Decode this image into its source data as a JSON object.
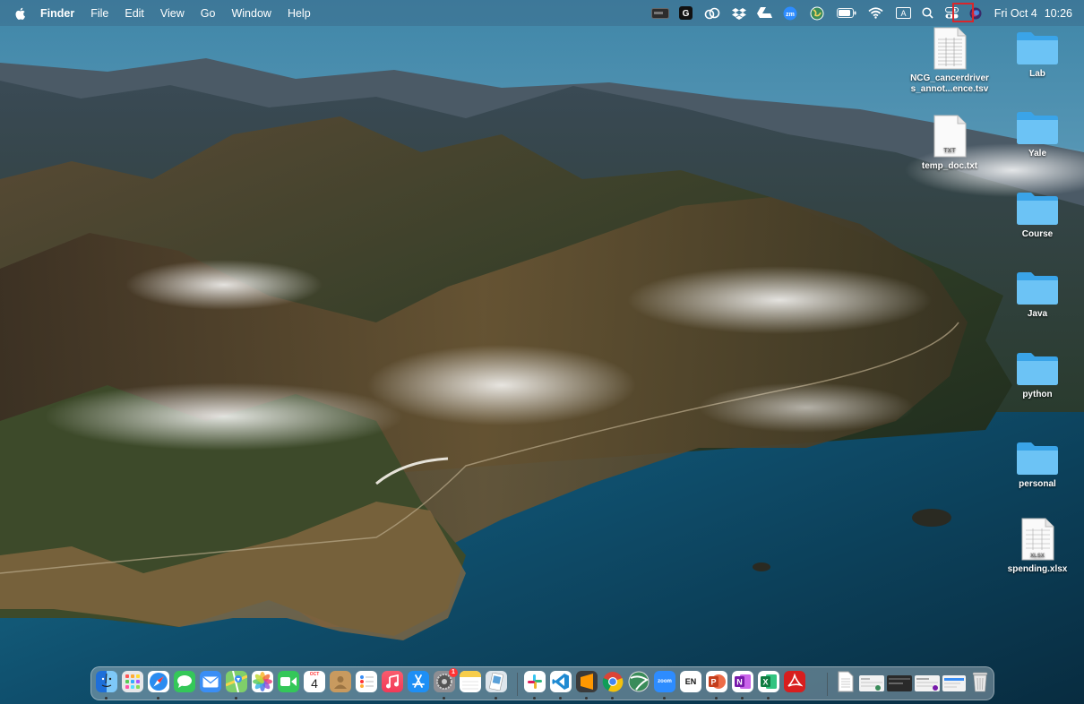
{
  "menubar": {
    "app_name": "Finder",
    "menus": [
      "File",
      "Edit",
      "View",
      "Go",
      "Window",
      "Help"
    ],
    "status_icons": [
      "disk-icon",
      "grammarly-icon",
      "creative-cloud-icon",
      "dropbox-icon",
      "google-drive-icon",
      "zoom-icon",
      "globe-icon",
      "battery-icon",
      "wifi-icon",
      "input-source-icon",
      "spotlight-search-icon",
      "control-center-icon",
      "siri-icon"
    ],
    "zoom_label": "zm",
    "input_source_label": "A",
    "date": "Fri Oct 4",
    "time": "10:26"
  },
  "desktop": {
    "files": [
      {
        "name": "NCG_cancerdrivers_annot...ence.tsv",
        "line1": "NCG_cancerdriver",
        "line2": "s_annot...ence.tsv",
        "type": "tsv"
      },
      {
        "name": "temp_doc.txt",
        "type": "txt",
        "badge": "TXT"
      },
      {
        "name": "spending.xlsx",
        "type": "xlsx",
        "badge": "XLSX"
      }
    ],
    "folders": [
      "Lab",
      "Yale",
      "Course",
      "Java",
      "python",
      "personal"
    ]
  },
  "dock": {
    "apps": [
      "Finder",
      "Launchpad",
      "Safari",
      "Messages",
      "Mail",
      "Maps",
      "Photos",
      "FaceTime",
      "Calendar",
      "Contacts",
      "Reminders",
      "Music",
      "App Store",
      "System Preferences",
      "Notes",
      "Preview",
      "Slack",
      "Visual Studio Code",
      "Sublime Text",
      "Google Chrome",
      "Earth",
      "Zoom",
      "EN",
      "PowerPoint",
      "OneNote",
      "Excel",
      "Acrobat"
    ],
    "calendar": {
      "month": "OCT",
      "day": "4"
    },
    "zoom_label": "zoom",
    "en_label": "EN",
    "system_preferences_badge": "1",
    "right_items": [
      "Documents",
      "Recent Window 1",
      "Recent Window 2",
      "Recent Window 3",
      "Recent Window 4",
      "Trash"
    ]
  }
}
